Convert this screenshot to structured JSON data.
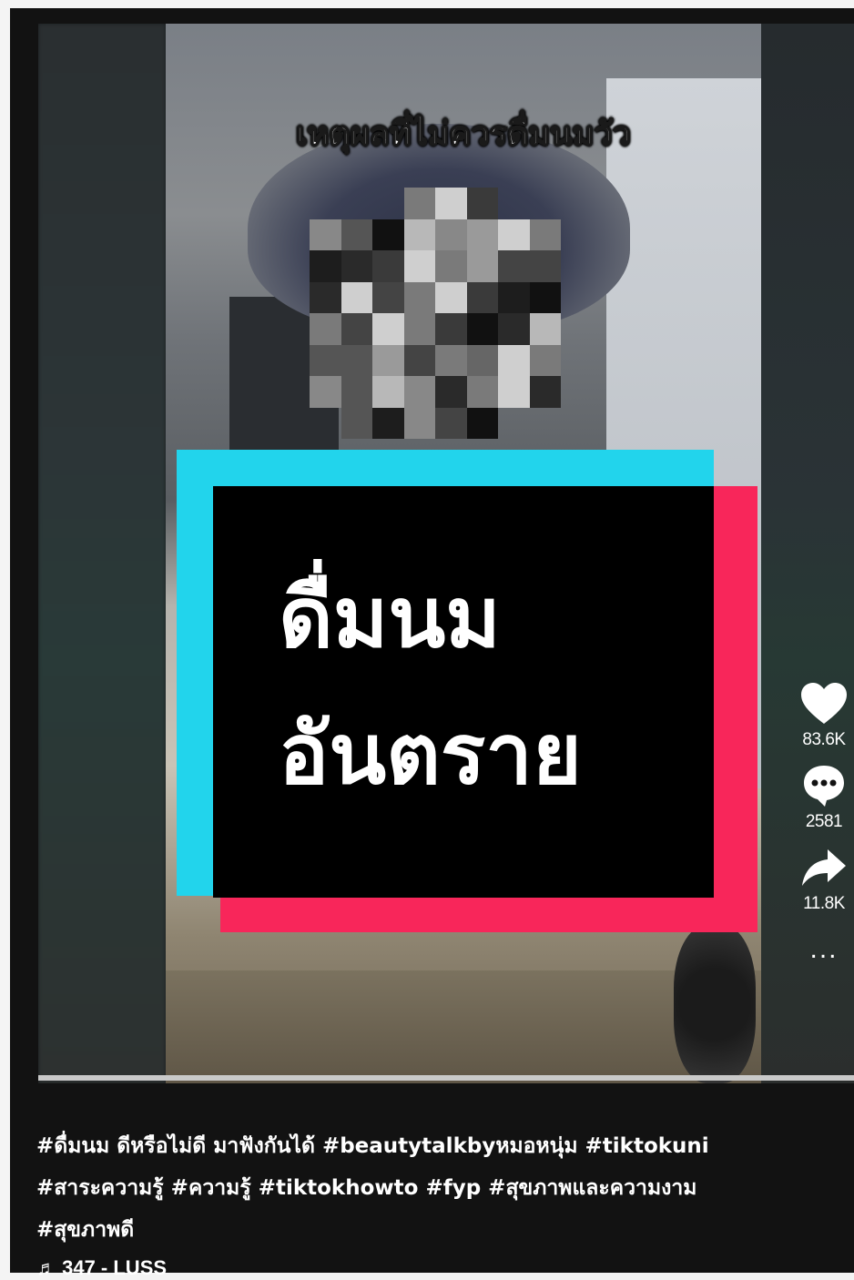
{
  "video": {
    "overlay_caption": "เหตุผลที่ไม่ควรดื่มนมวัว",
    "title_card_line1": "ดื่มนม",
    "title_card_line2": "อันตราย",
    "progress_fraction": 1.0
  },
  "actions": {
    "like_count": "83.6K",
    "comment_count": "2581",
    "share_count": "11.8K",
    "more_label": "..."
  },
  "description": {
    "line1": "#ดื่มนม ดีหรือไม่ดี มาฟังกันได้ #beautytalkbyหมอหนุ่ม #tiktokuni",
    "line2": "#สาระความรู้ #ความรู้ #tiktokhowto #fyp #สุขภาพและความงาม",
    "line3": "#สุขภาพดี"
  },
  "music": {
    "label": "♬ 347 - LUSS"
  },
  "colors": {
    "tiktok_cyan": "#22d4ec",
    "tiktok_red": "#f8265a",
    "background": "#121212"
  }
}
